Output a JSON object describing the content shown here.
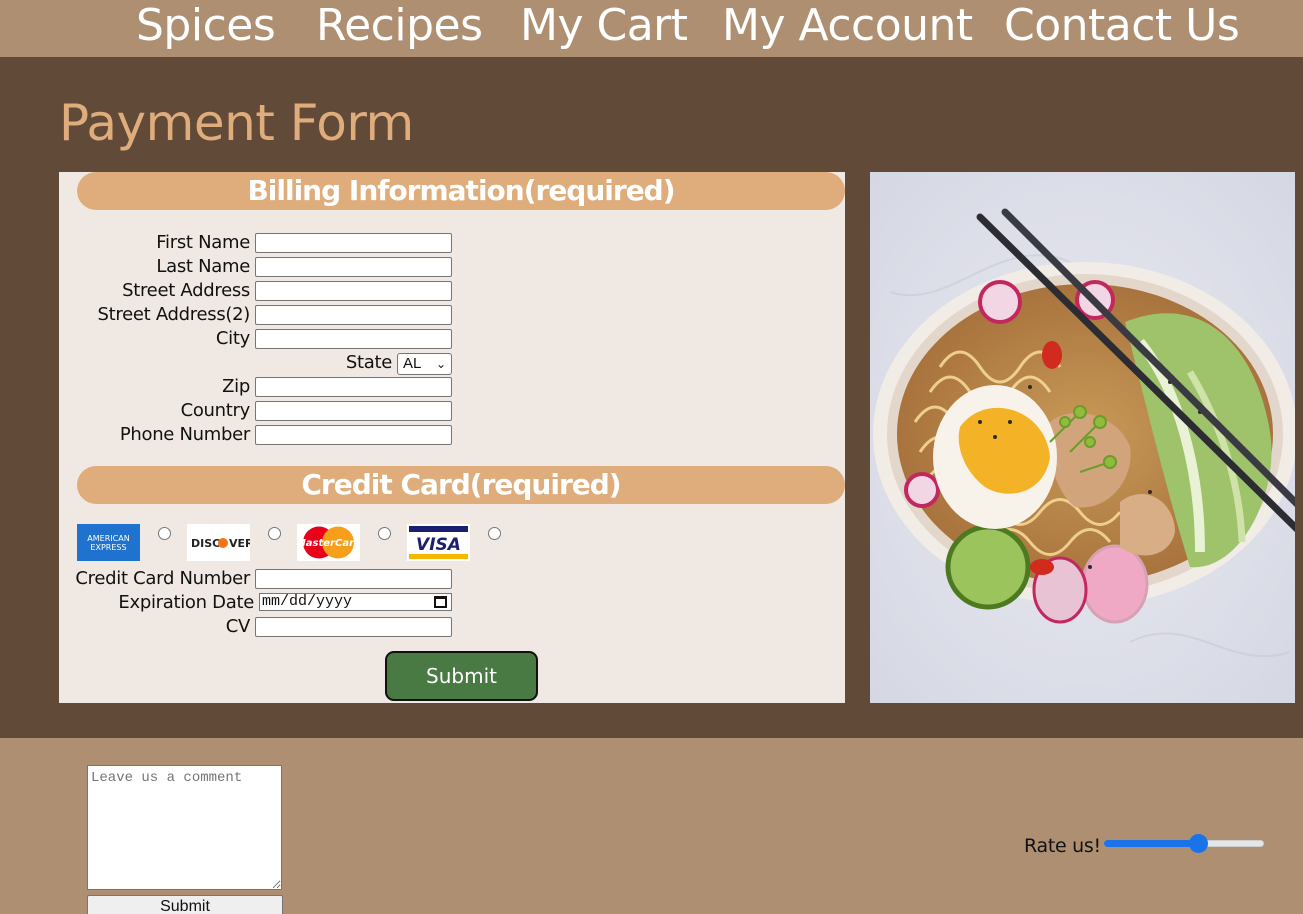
{
  "nav": {
    "items": [
      {
        "label": "Spices"
      },
      {
        "label": "Recipes"
      },
      {
        "label": "My Cart"
      },
      {
        "label": "My Account"
      },
      {
        "label": "Contact Us"
      }
    ]
  },
  "page": {
    "title": "Payment Form"
  },
  "billing": {
    "header": "Billing Information(required)",
    "fields": [
      {
        "label": "First Name",
        "value": ""
      },
      {
        "label": "Last Name",
        "value": ""
      },
      {
        "label": "Street Address",
        "value": ""
      },
      {
        "label": "Street Address(2)",
        "value": ""
      },
      {
        "label": "City",
        "value": ""
      },
      {
        "label": "Zip",
        "value": ""
      },
      {
        "label": "Country",
        "value": ""
      },
      {
        "label": "Phone Number",
        "value": ""
      }
    ],
    "state": {
      "label": "State",
      "value": "AL"
    }
  },
  "credit": {
    "header": "Credit Card(required)",
    "cards": [
      {
        "name": "American Express",
        "logo_text": "AMERICAN EXPRESS",
        "color": "#1f72cd",
        "icon": "amex-logo"
      },
      {
        "name": "Discover",
        "logo_text": "DISCOVER",
        "color": "#f47216",
        "icon": "discover-logo"
      },
      {
        "name": "MasterCard",
        "logo_text": "MasterCard",
        "color": "#eb001b",
        "icon": "mastercard-logo"
      },
      {
        "name": "Visa",
        "logo_text": "VISA",
        "color": "#1a1f71",
        "icon": "visa-logo"
      }
    ],
    "number_label": "Credit Card Number",
    "expiration_label": "Expiration Date",
    "expiration_placeholder": "mm/dd/yyyy",
    "cv_label": "CV",
    "submit_label": "Submit"
  },
  "footer": {
    "comment_placeholder": "Leave us a comment",
    "submit_label": "Submit",
    "rate_label": "Rate us!",
    "rating": 0.6
  },
  "colors": {
    "nav_bg": "#af8f71",
    "main_bg": "#614a38",
    "accent": "#dfac7c",
    "panel_bg": "#f0e9e3",
    "submit_green": "#497a43",
    "slider_blue": "#1a73e8"
  }
}
